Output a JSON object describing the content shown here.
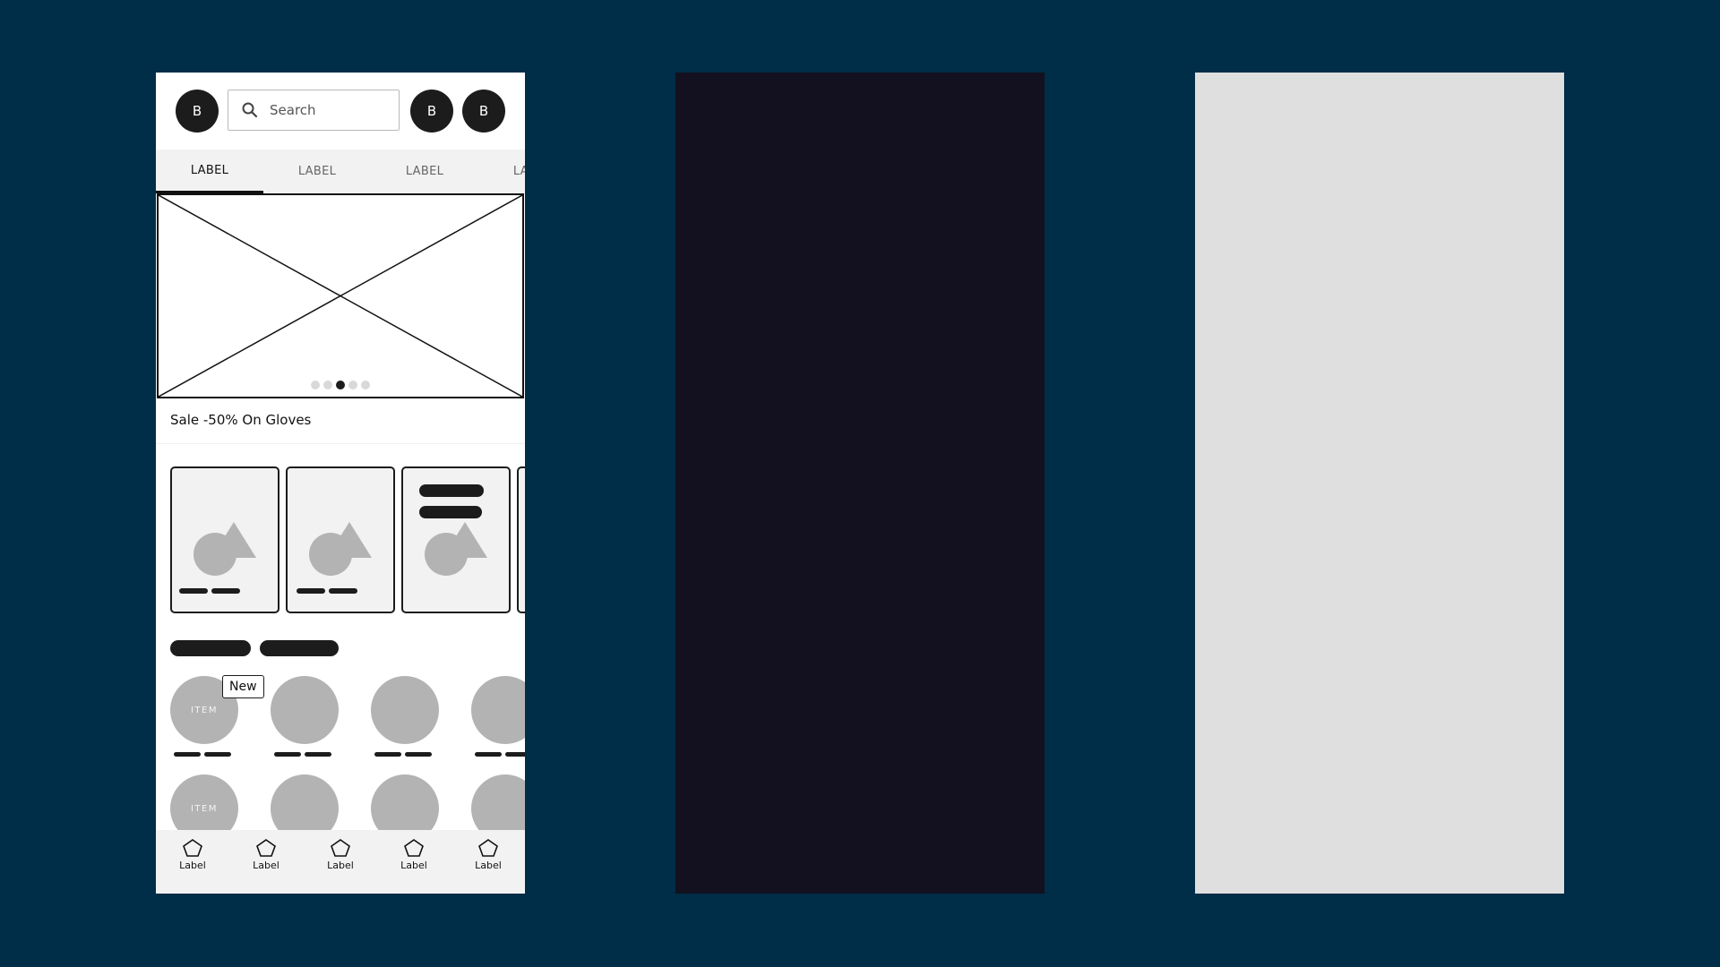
{
  "colors": {
    "background": "#002d47",
    "frame_dark": "#13111f",
    "frame_light": "#dfdfdf",
    "accent": "#1c1c1c",
    "placeholder_gray": "#b3b3b3"
  },
  "topbar": {
    "avatar_left": "B",
    "search": {
      "placeholder": "Search",
      "icon": "search-icon"
    },
    "avatar_right_1": "B",
    "avatar_right_2": "B"
  },
  "tabs": [
    "LABEL",
    "LABEL",
    "LABEL",
    "LABEL"
  ],
  "hero": {
    "slide_count": 5,
    "active_slide": 3
  },
  "sale_text": "Sale -50% On Gloves",
  "items": {
    "label": "ITEM",
    "badge": "New"
  },
  "bottom_nav": [
    "Label",
    "Label",
    "Label",
    "Label",
    "Label"
  ]
}
